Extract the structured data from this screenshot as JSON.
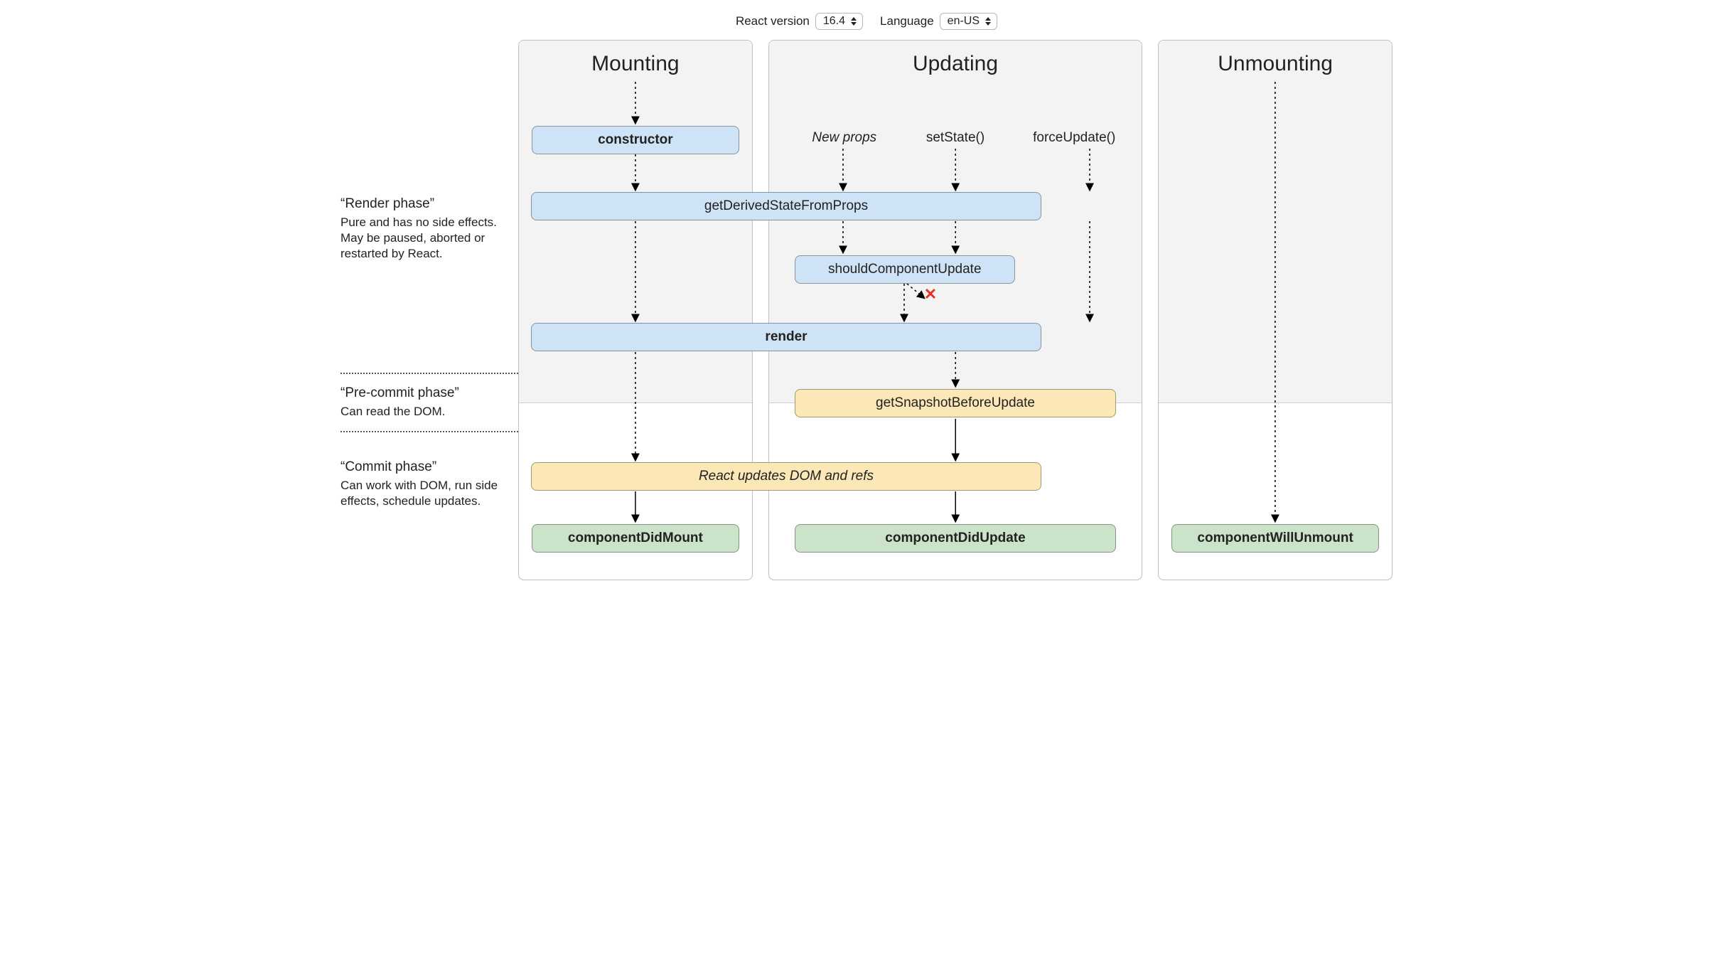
{
  "toolbar": {
    "version_label": "React version",
    "version_value": "16.4",
    "language_label": "Language",
    "language_value": "en-US"
  },
  "columns": {
    "mounting": "Mounting",
    "updating": "Updating",
    "unmounting": "Unmounting"
  },
  "phases": {
    "render": {
      "title": "Render phase",
      "desc": "Pure and has no side effects. May be paused, aborted or restarted by React."
    },
    "precommit": {
      "title": "Pre-commit phase",
      "desc": "Can read the DOM."
    },
    "commit": {
      "title": "Commit phase",
      "desc": "Can work with DOM, run side effects, schedule updates."
    }
  },
  "triggers": {
    "new_props": "New props",
    "set_state": "setState()",
    "force_update": "forceUpdate()"
  },
  "methods": {
    "constructor": "constructor",
    "gdsfp": "getDerivedStateFromProps",
    "scu": "shouldComponentUpdate",
    "render": "render",
    "gsbu": "getSnapshotBeforeUpdate",
    "react_updates": "React updates DOM and refs",
    "cdm": "componentDidMount",
    "cdu": "componentDidUpdate",
    "cwu": "componentWillUnmount"
  },
  "x_mark": "✕"
}
